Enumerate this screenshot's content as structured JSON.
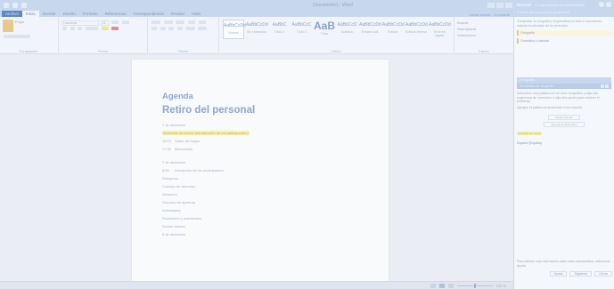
{
  "window": {
    "title": "Documento1 - Word"
  },
  "tabs": [
    {
      "label": "Archivo",
      "kind": "file"
    },
    {
      "label": "Inicio",
      "kind": "active"
    },
    {
      "label": "Insertar",
      "kind": ""
    },
    {
      "label": "Diseño",
      "kind": ""
    },
    {
      "label": "Formato",
      "kind": ""
    },
    {
      "label": "Referencias",
      "kind": ""
    },
    {
      "label": "Correspondencia",
      "kind": ""
    },
    {
      "label": "Revisar",
      "kind": ""
    },
    {
      "label": "Vista",
      "kind": ""
    }
  ],
  "tabs_right": {
    "signin": "Iniciar sesión",
    "share": "Compartir"
  },
  "ribbon": {
    "paste_label": "Pegar",
    "font_name": "Cambria",
    "font_size": "11",
    "styles": [
      {
        "sample": "AaBbCcDd",
        "name": "Normal",
        "big": false,
        "selected": true
      },
      {
        "sample": "AaBbCcDd",
        "name": "Sin espaciado",
        "big": false,
        "selected": false
      },
      {
        "sample": "AaBbC",
        "name": "Título 1",
        "big": false,
        "selected": false
      },
      {
        "sample": "AaBbCcC",
        "name": "Título 2",
        "big": false,
        "selected": false
      },
      {
        "sample": "AaB",
        "name": "Título",
        "big": true,
        "selected": false
      },
      {
        "sample": "AaBbCcD",
        "name": "Subtítulo",
        "big": false,
        "selected": false
      },
      {
        "sample": "AaBbCcDd",
        "name": "Énfasis sutil",
        "big": false,
        "selected": false
      },
      {
        "sample": "AaBbCcDd",
        "name": "Énfasis",
        "big": false,
        "selected": false
      },
      {
        "sample": "AaBbCcDd",
        "name": "Énfasis intenso",
        "big": false,
        "selected": false
      },
      {
        "sample": "AaBbCcDd",
        "name": "Texto en negrita",
        "big": false,
        "selected": false
      }
    ],
    "editing": [
      "Buscar",
      "Reemplazar",
      "Seleccionar"
    ],
    "group_labels": {
      "clipboard": "Portapapeles",
      "font": "Fuente",
      "paragraph": "Párrafo",
      "styles": "Estilos",
      "editing": "Edición"
    }
  },
  "document": {
    "title": "Agenda",
    "subtitle": "Retiro del personal",
    "lines": [
      {
        "text": "7 de diciembre",
        "hl": false,
        "gap_before": false
      },
      {
        "text": "Actividad de enlace (introducción de los participantes)",
        "hl": true,
        "gap_before": false
      },
      {
        "text": "Salón del hogar",
        "time": "16:00",
        "hl": false,
        "gap_before": false
      },
      {
        "text": "Bienvenida",
        "time": "17:30",
        "hl": false,
        "gap_before": false
      },
      {
        "text": "7 de diciembre",
        "hl": false,
        "gap_before": true
      },
      {
        "text": "Inscripción de los participantes",
        "time": "8:00",
        "hl": false,
        "gap_before": false
      },
      {
        "text": "Desayuno",
        "hl": false,
        "gap_before": false
      },
      {
        "text": "Consejo de dirección",
        "hl": false,
        "gap_before": false
      },
      {
        "text": "Almuerzo",
        "hl": false,
        "gap_before": false
      },
      {
        "text": "Discurso de apertura",
        "hl": false,
        "gap_before": false
      },
      {
        "text": "Actividades",
        "hl": false,
        "gap_before": false
      },
      {
        "text": "Planeación y actividades",
        "hl": false,
        "gap_before": false
      },
      {
        "text": "Sesión abierta",
        "hl": false,
        "gap_before": false
      },
      {
        "text": "8 de diciembre",
        "hl": false,
        "gap_before": false
      }
    ]
  },
  "statusbar": {
    "zoom": "100 %"
  },
  "pane": {
    "header_title": "Revisor",
    "header_right": "Comprobación de accesibilidad",
    "subtitle": "Errores de ortografía y gramática",
    "intro": "Comprobar la ortografía y la gramática en todo el documento, incluida la ubicación de la corrección.",
    "option1": "Ortografía",
    "option2": "Gramática y claridad",
    "section_head": "Ortografía",
    "section_sub": "Resultados de ortografía",
    "details": "Seleccione una palabra con un error ortográfico y elija una sugerencia de corrección o elija otra opción para resolver el problema.",
    "details2": "Agregue la palabra al diccionario si es correcta.",
    "box1": "Omitir una vez",
    "box2": "Agregar al diccionario",
    "highlight_sample": "Actividad de enlace",
    "idioma": "Español (España)",
    "footer_note": "Para obtener más información sobre esta característica, seleccione Ayuda.",
    "buttons": [
      "Ayuda",
      "Siguiente",
      "Cerrar"
    ]
  }
}
